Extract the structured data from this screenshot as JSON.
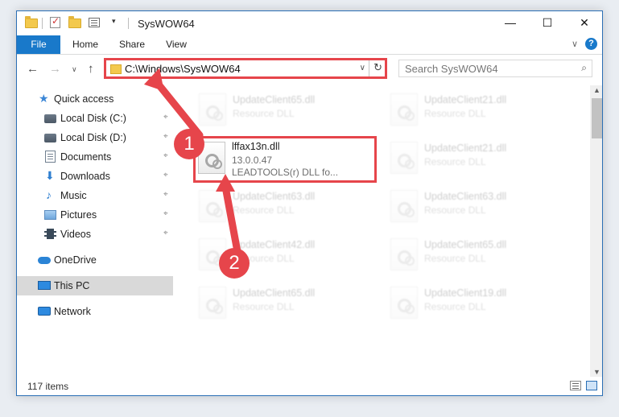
{
  "window": {
    "title": "SysWOW64",
    "controls": {
      "minimize": "—",
      "maximize": "☐",
      "close": "✕"
    }
  },
  "quick_access_toolbar": {
    "dropdown": "▾"
  },
  "ribbon": {
    "tabs": [
      "File",
      "Home",
      "Share",
      "View"
    ],
    "collapse_glyph": "∨",
    "help_glyph": "?"
  },
  "navigation": {
    "back": "←",
    "forward": "→",
    "recent": "∨",
    "up": "↑",
    "address_path": "C:\\Windows\\SysWOW64",
    "address_dropdown": "∨",
    "refresh": "↻",
    "search_placeholder": "Search SysWOW64",
    "search_glyph": "⌕"
  },
  "sidebar": {
    "items": [
      {
        "label": "Quick access",
        "icon": "star-icon",
        "pinned": false
      },
      {
        "label": "Local Disk (C:)",
        "icon": "disk-icon",
        "pinned": true
      },
      {
        "label": "Local Disk (D:)",
        "icon": "disk-icon",
        "pinned": true
      },
      {
        "label": "Documents",
        "icon": "documents-icon",
        "pinned": true
      },
      {
        "label": "Downloads",
        "icon": "download-icon",
        "pinned": true
      },
      {
        "label": "Music",
        "icon": "music-icon",
        "pinned": true
      },
      {
        "label": "Pictures",
        "icon": "pictures-icon",
        "pinned": true
      },
      {
        "label": "Videos",
        "icon": "videos-icon",
        "pinned": true
      },
      {
        "label": "OneDrive",
        "icon": "cloud-icon",
        "pinned": false
      },
      {
        "label": "This PC",
        "icon": "computer-icon",
        "pinned": false,
        "selected": true
      },
      {
        "label": "Network",
        "icon": "network-icon",
        "pinned": false
      }
    ],
    "pin_glyph": "⌖"
  },
  "files": {
    "highlighted": {
      "name": "lffax13n.dll",
      "version": "13.0.0.47",
      "description": "LEADTOOLS(r) DLL fo..."
    },
    "faded": [
      {
        "name": "UpdateClient65.dll",
        "type": "Resource DLL"
      },
      {
        "name": "UpdateClient21.dll",
        "type": "Resource DLL"
      },
      {
        "name": "UpdateClient63.dll",
        "type": "Resource DLL"
      },
      {
        "name": "UpdateClient21.dll",
        "type": "Resource DLL"
      },
      {
        "name": "UpdateClient63.dll",
        "type": "Resource DLL"
      },
      {
        "name": "UpdateClient42.dll",
        "type": "Resource DLL"
      },
      {
        "name": "UpdateClient65.dll",
        "type": "Resource DLL"
      },
      {
        "name": "UpdateClient65.dll",
        "type": "Resource DLL"
      },
      {
        "name": "UpdateClient19.dll",
        "type": "Resource DLL"
      }
    ]
  },
  "status": {
    "item_count": "117 items"
  },
  "scrollbar": {
    "up": "▲",
    "down": "▼"
  },
  "annotations": {
    "badge_1": "1",
    "badge_2": "2",
    "color": "#e6454b"
  }
}
